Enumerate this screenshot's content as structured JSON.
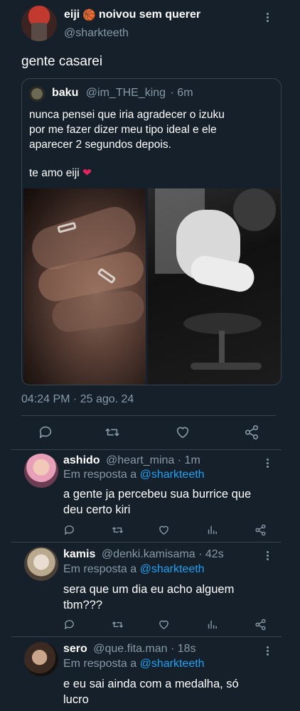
{
  "main_tweet": {
    "author_name": "eiji",
    "status_emoji": "🏀",
    "author_suffix": "noivou sem querer",
    "handle": "@sharkteeth",
    "text": "gente casarei",
    "timestamp": "04:24 PM · 25 ago. 24"
  },
  "quoted_tweet": {
    "author_name": "baku",
    "handle": "@im_THE_king",
    "time": "· 6m",
    "line1": "nunca pensei que iria agradecer o izuku",
    "line2": "por me fazer dizer meu tipo ideal e ele",
    "line3": "aparecer 2 segundos depois.",
    "line4": "te amo eiji",
    "heart": "❤"
  },
  "replies": [
    {
      "name": "ashido",
      "handle": "@heart_mina",
      "time": "· 1m",
      "reply_prefix": "Em resposta a",
      "reply_to": "@sharkteeth",
      "line1": "a gente ja percebeu sua burrice que",
      "line2": "deu certo kiri"
    },
    {
      "name": "kamis",
      "handle": "@denki.kamisama",
      "time": "· 42s",
      "reply_prefix": "Em resposta a",
      "reply_to": "@sharkteeth",
      "line1": "sera que um dia eu acho alguem",
      "line2": "tbm???"
    },
    {
      "name": "sero",
      "handle": "@que.fita.man",
      "time": "· 18s",
      "reply_prefix": "Em resposta a",
      "reply_to": "@sharkteeth",
      "line1": "e eu sai ainda com a medalha, só",
      "line2": "lucro"
    }
  ],
  "colors": {
    "background": "#15202b",
    "muted": "#8899a6",
    "link": "#1da1f2",
    "border": "#38444d",
    "heart": "#e0245e"
  },
  "icons": [
    "reply-icon",
    "retweet-icon",
    "like-icon",
    "share-icon",
    "analytics-icon",
    "more-icon"
  ]
}
